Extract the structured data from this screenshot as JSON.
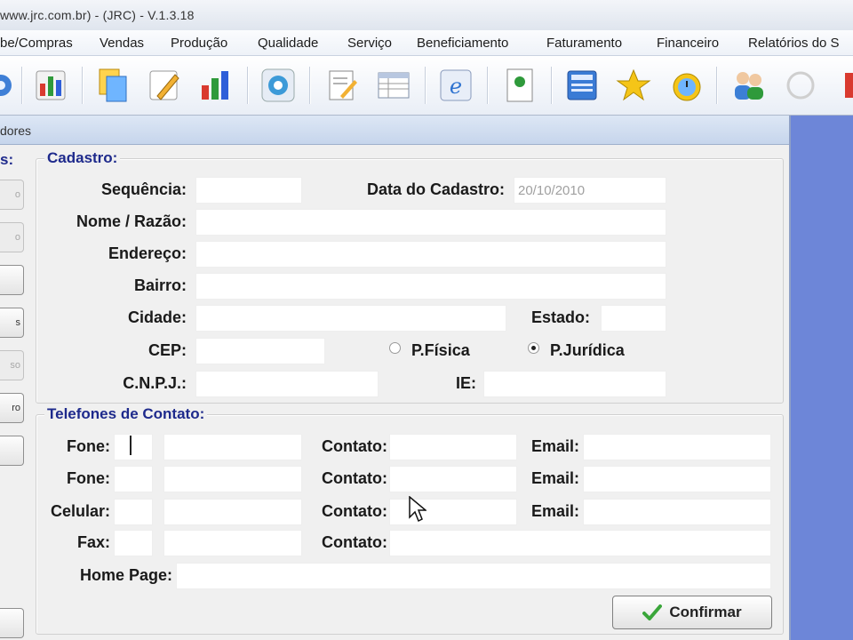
{
  "window": {
    "title": "www.jrc.com.br) - (JRC) - V.1.3.18"
  },
  "menu": [
    {
      "label": "be/Compras"
    },
    {
      "label": "Vendas"
    },
    {
      "label": "Produção"
    },
    {
      "label": "Qualidade"
    },
    {
      "label": "Serviço"
    },
    {
      "label": "Beneficiamento"
    },
    {
      "label": "Faturamento"
    },
    {
      "label": "Financeiro"
    },
    {
      "label": "Relatórios do S"
    }
  ],
  "toolbar_icons": [
    "gear-icon",
    "chart-icon",
    "copy-icon",
    "note-icon",
    "bar-chart-icon",
    "refresh-icon",
    "edit-icon",
    "list-icon",
    "browser-icon",
    "document-icon",
    "calculator-icon",
    "star-icon",
    "clock-icon",
    "users-icon",
    "disabled-icon",
    "exit-icon"
  ],
  "form": {
    "title": "dores",
    "side_buttons": [
      {
        "label": "o",
        "disabled": true
      },
      {
        "label": "o",
        "disabled": true
      },
      {
        "label": "",
        "disabled": false
      },
      {
        "label": "s",
        "disabled": false
      },
      {
        "label": "so",
        "disabled": true
      },
      {
        "label": "ro",
        "disabled": false
      },
      {
        "label": "",
        "disabled": false
      },
      {
        "label": "",
        "disabled": false
      }
    ],
    "left_label": "s:",
    "cadastro": {
      "title": "Cadastro:",
      "sequencia_label": "Sequência:",
      "data_label": "Data do Cadastro:",
      "data_value": "20/10/2010",
      "nome_label": "Nome / Razão:",
      "endereco_label": "Endereço:",
      "bairro_label": "Bairro:",
      "cidade_label": "Cidade:",
      "estado_label": "Estado:",
      "cep_label": "CEP:",
      "pfisica_label": "P.Física",
      "pjuridica_label": "P.Jurídica",
      "selected_type": "P.Jurídica",
      "cnpj_label": "C.N.P.J.:",
      "ie_label": "IE:"
    },
    "telefones": {
      "title": "Telefones de Contato:",
      "rows": [
        {
          "label": "Fone:",
          "contato": "Contato:",
          "email": "Email:"
        },
        {
          "label": "Fone:",
          "contato": "Contato:",
          "email": "Email:"
        },
        {
          "label": "Celular:",
          "contato": "Contato:",
          "email": "Email:"
        },
        {
          "label": "Fax:",
          "contato": "Contato:",
          "email": ""
        }
      ],
      "homepage_label": "Home Page:"
    },
    "confirm_label": "Confirmar"
  },
  "colors": {
    "desktop": "#6d86d8",
    "group_title": "#1e2a8c"
  }
}
